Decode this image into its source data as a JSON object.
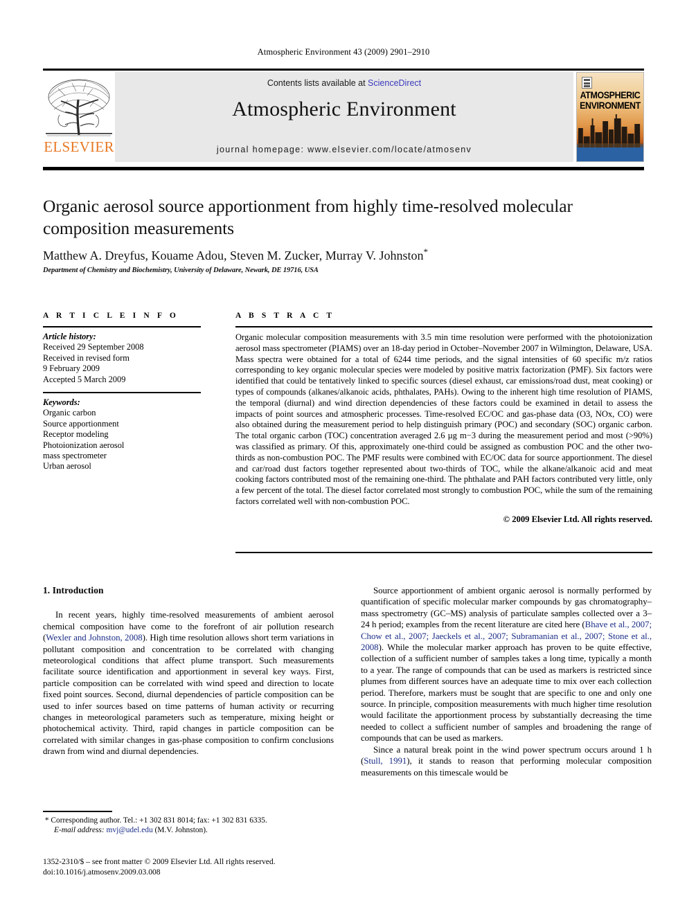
{
  "running_head": "Atmospheric Environment 43 (2009) 2901–2910",
  "banner": {
    "publisher_name": "ELSEVIER",
    "contents_prefix": "Contents lists available at ",
    "sciencedirect": "ScienceDirect",
    "journal_name": "Atmospheric Environment",
    "homepage": "journal homepage: www.elsevier.com/locate/atmosenv",
    "cover_title_line1": "ATMOSPHERIC",
    "cover_title_line2": "ENVIRONMENT",
    "sciencedirect_color": "#3b3bbd",
    "elsevier_orange": "#E87722"
  },
  "article": {
    "title": "Organic aerosol source apportionment from highly time-resolved molecular composition measurements",
    "authors": "Matthew A. Dreyfus, Kouame Adou, Steven M. Zucker, Murray V. Johnston",
    "corresponding_marker": "*",
    "affiliation": "Department of Chemistry and Biochemistry, University of Delaware, Newark, DE 19716, USA"
  },
  "article_info": {
    "heading": "A R T I C L E   I N F O",
    "history_label": "Article history:",
    "history": [
      "Received 29 September 2008",
      "Received in revised form",
      "9 February 2009",
      "Accepted 5 March 2009"
    ],
    "keywords_label": "Keywords:",
    "keywords": [
      "Organic carbon",
      "Source apportionment",
      "Receptor modeling",
      "Photoionization aerosol",
      "mass spectrometer",
      "Urban aerosol"
    ]
  },
  "abstract": {
    "heading": "A B S T R A C T",
    "text": "Organic molecular composition measurements with 3.5 min time resolution were performed with the photoionization aerosol mass spectrometer (PIAMS) over an 18-day period in October–November 2007 in Wilmington, Delaware, USA. Mass spectra were obtained for a total of 6244 time periods, and the signal intensities of 60 specific m/z ratios corresponding to key organic molecular species were modeled by positive matrix factorization (PMF). Six factors were identified that could be tentatively linked to specific sources (diesel exhaust, car emissions/road dust, meat cooking) or types of compounds (alkanes/alkanoic acids, phthalates, PAHs). Owing to the inherent high time resolution of PIAMS, the temporal (diurnal) and wind direction dependencies of these factors could be examined in detail to assess the impacts of point sources and atmospheric processes. Time-resolved EC/OC and gas-phase data (O3, NOx, CO) were also obtained during the measurement period to help distinguish primary (POC) and secondary (SOC) organic carbon. The total organic carbon (TOC) concentration averaged 2.6 µg m−3 during the measurement period and most (>90%) was classified as primary. Of this, approximately one-third could be assigned as combustion POC and the other two-thirds as non-combustion POC. The PMF results were combined with EC/OC data for source apportionment. The diesel and car/road dust factors together represented about two-thirds of TOC, while the alkane/alkanoic acid and meat cooking factors contributed most of the remaining one-third. The phthalate and PAH factors contributed very little, only a few percent of the total. The diesel factor correlated most strongly to combustion POC, while the sum of the remaining factors correlated well with non-combustion POC.",
    "copyright": "© 2009 Elsevier Ltd. All rights reserved."
  },
  "body": {
    "section_heading": "1. Introduction",
    "left_p1_a": "In recent years, highly time-resolved measurements of ambient aerosol chemical composition have come to the forefront of air pollution research (",
    "left_p1_cite1": "Wexler and Johnston, 2008",
    "left_p1_b": "). High time resolution allows short term variations in pollutant composition and concentration to be correlated with changing meteorological conditions that affect plume transport. Such measurements facilitate source identification and apportionment in several key ways. First, particle composition can be correlated with wind speed and direction to locate fixed point sources. Second, diurnal dependencies of particle composition can be used to infer sources based on time patterns of human activity or recurring changes in meteorological parameters such as temperature, mixing height or photochemical activity. Third, rapid changes in particle composition can be correlated with similar changes in gas-phase composition to confirm conclusions drawn from wind and diurnal dependencies.",
    "right_p1_a": "Source apportionment of ambient organic aerosol is normally performed by quantification of specific molecular marker compounds by gas chromatography–mass spectrometry (GC–MS) analysis of particulate samples collected over a 3–24 h period; examples from the recent literature are cited here (",
    "right_p1_cite": "Bhave et al., 2007; Chow et al., 2007; Jaeckels et al., 2007; Subramanian et al., 2007; Stone et al., 2008",
    "right_p1_b": "). While the molecular marker approach has proven to be quite effective, collection of a sufficient number of samples takes a long time, typically a month to a year. The range of compounds that can be used as markers is restricted since plumes from different sources have an adequate time to mix over each collection period. Therefore, markers must be sought that are specific to one and only one source. In principle, composition measurements with much higher time resolution would facilitate the apportionment process by substantially decreasing the time needed to collect a sufficient number of samples and broadening the range of compounds that can be used as markers.",
    "right_p2_a": "Since a natural break point in the wind power spectrum occurs around 1 h (",
    "right_p2_cite": "Stull, 1991",
    "right_p2_b": "), it stands to reason that performing molecular composition measurements on this timescale would be"
  },
  "footer": {
    "corresponding_marker": "*",
    "corresponding": "Corresponding author. Tel.: +1 302 831 8014; fax: +1 302 831 6335.",
    "email_label": "E-mail address:",
    "email": "mvj@udel.edu",
    "email_suffix": "(M.V. Johnston).",
    "imprint_line1": "1352-2310/$ – see front matter © 2009 Elsevier Ltd. All rights reserved.",
    "imprint_line2": "doi:10.1016/j.atmosenv.2009.03.008"
  }
}
